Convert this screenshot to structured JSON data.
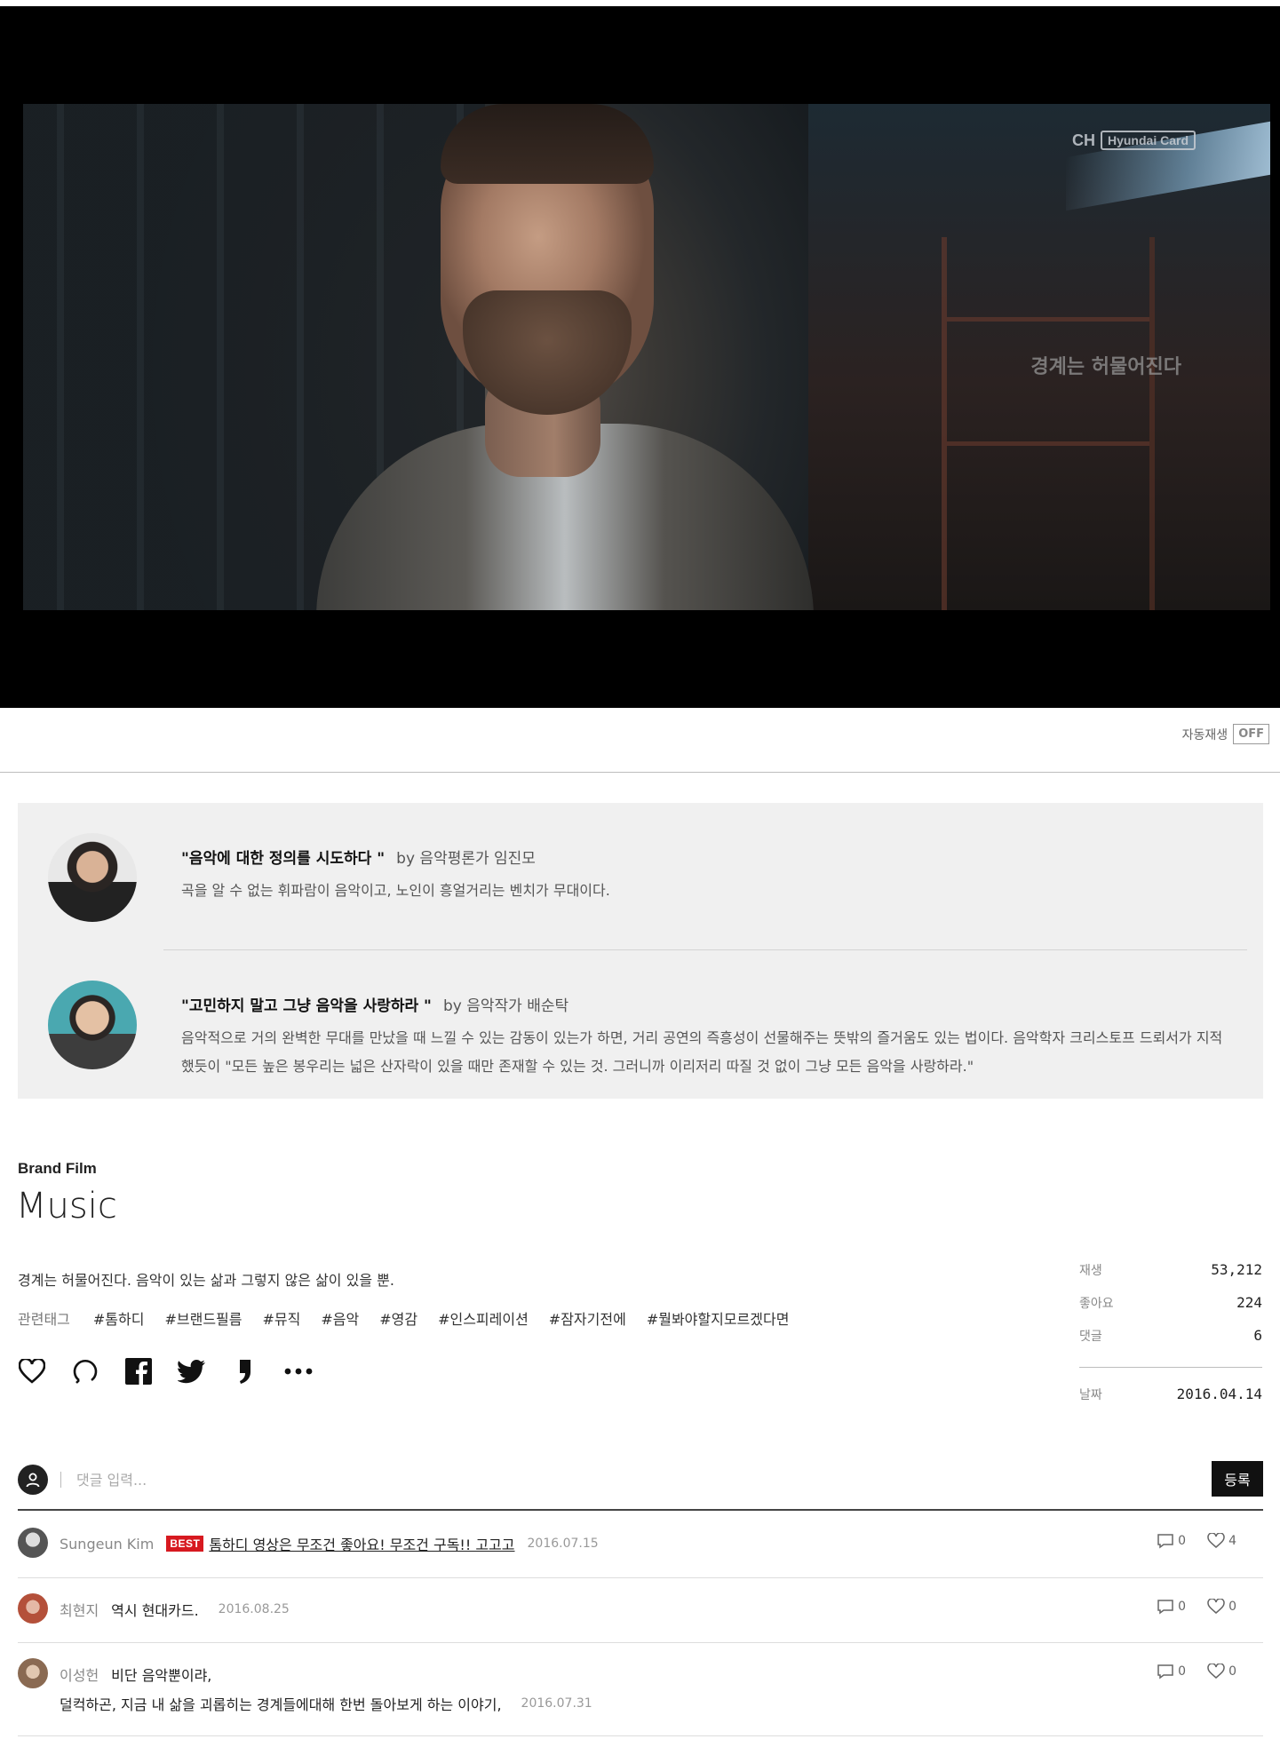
{
  "video": {
    "watermark_brand": "CH",
    "watermark_box": "Hyundai Card",
    "subtitle": "경계는 허물어진다"
  },
  "autoplay": {
    "label": "자동재생",
    "state": "OFF"
  },
  "reviews": [
    {
      "title": "\"음악에 대한 정의를 시도하다 \"",
      "by": "by 음악평론가 임진모",
      "text": "곡을 알 수 없는 휘파람이 음악이고, 노인이 흥얼거리는 벤치가 무대이다."
    },
    {
      "title": "\"고민하지 말고 그냥 음악을 사랑하라 \"",
      "by": "by 음악작가 배순탁",
      "text": "음악적으로 거의 완벽한 무대를 만났을 때 느낄 수 있는 감동이 있는가 하면, 거리 공연의 즉흥성이 선물해주는 뜻밖의 즐거움도 있는 법이다. 음악학자 크리스토프 드뢰서가 지적했듯이 \"모든 높은 봉우리는 넓은 산자락이 있을 때만 존재할 수 있는 것. 그러니까 이리저리 따질 것 없이 그냥 모든 음악을 사랑하라.\""
    }
  ],
  "info": {
    "category": "Brand Film",
    "title": "Music",
    "description": "경계는 허물어진다. 음악이 있는 삶과 그렇지 않은 삶이 있을 뿐.",
    "tags_label": "관련태그",
    "tags": [
      "#톰하디",
      "#브랜드필름",
      "#뮤직",
      "#음악",
      "#영감",
      "#인스피레이션",
      "#잠자기전에",
      "#뭘봐야할지모르겠다면"
    ]
  },
  "actions": [
    "heart-icon",
    "comment-icon",
    "facebook-icon",
    "twitter-icon",
    "quote-icon",
    "more-icon"
  ],
  "stats": {
    "plays_label": "재생",
    "plays": "53,212",
    "likes_label": "좋아요",
    "likes": "224",
    "comments_label": "댓글",
    "comments": "6",
    "date_label": "날짜",
    "date": "2016.04.14"
  },
  "comment_form": {
    "placeholder": "댓글 입력...",
    "submit": "등록"
  },
  "comments": [
    {
      "author": "Sungeun Kim",
      "badge": "BEST",
      "text": "톰하디 영상은 무조건 좋아요! 무조건 구독!! 고고고",
      "date": "2016.07.15",
      "replies": "0",
      "likes": "4"
    },
    {
      "author": "최현지",
      "text": "역시 현대카드.",
      "date": "2016.08.25",
      "replies": "0",
      "likes": "0"
    },
    {
      "author": "이성헌",
      "text": "비단 음악뿐이랴,",
      "text2": "덜컥하곤, 지금 내 삶을 괴롭히는 경계들에대해 한번 돌아보게 하는 이야기,",
      "date": "2016.07.31",
      "replies": "0",
      "likes": "0"
    }
  ]
}
